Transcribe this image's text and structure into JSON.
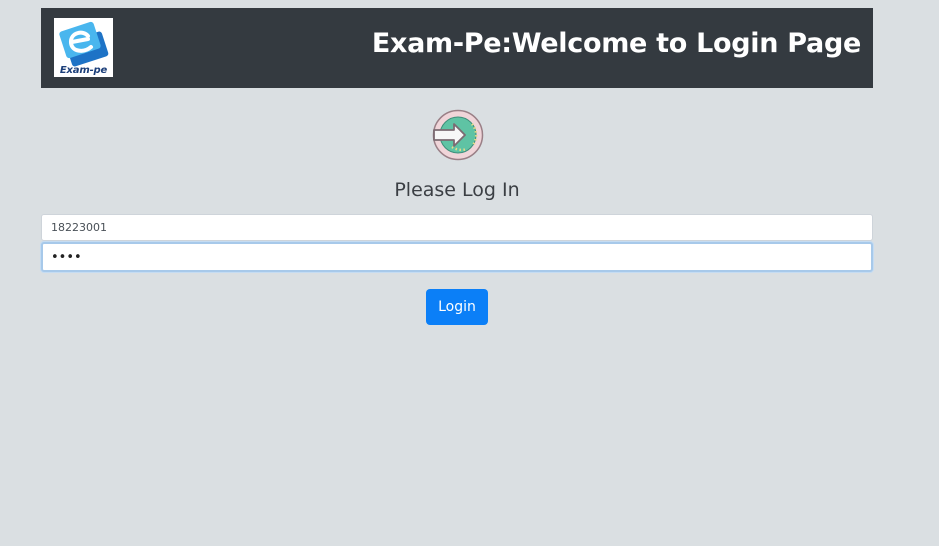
{
  "header": {
    "logo_text": "Exam-pe",
    "title": "Exam-Pe:Welcome to Login Page"
  },
  "main": {
    "subtitle": "Please Log In",
    "login_icon": "login-arrow-icon",
    "username": {
      "value": "18223001"
    },
    "password": {
      "value": "••••"
    },
    "login_label": "Login"
  },
  "colors": {
    "header_bg": "#343a40",
    "page_bg": "#dadfe2",
    "button_bg": "#0b7ff7",
    "icon_teal": "#5fc3a4",
    "icon_ring": "#f0d5d9"
  }
}
